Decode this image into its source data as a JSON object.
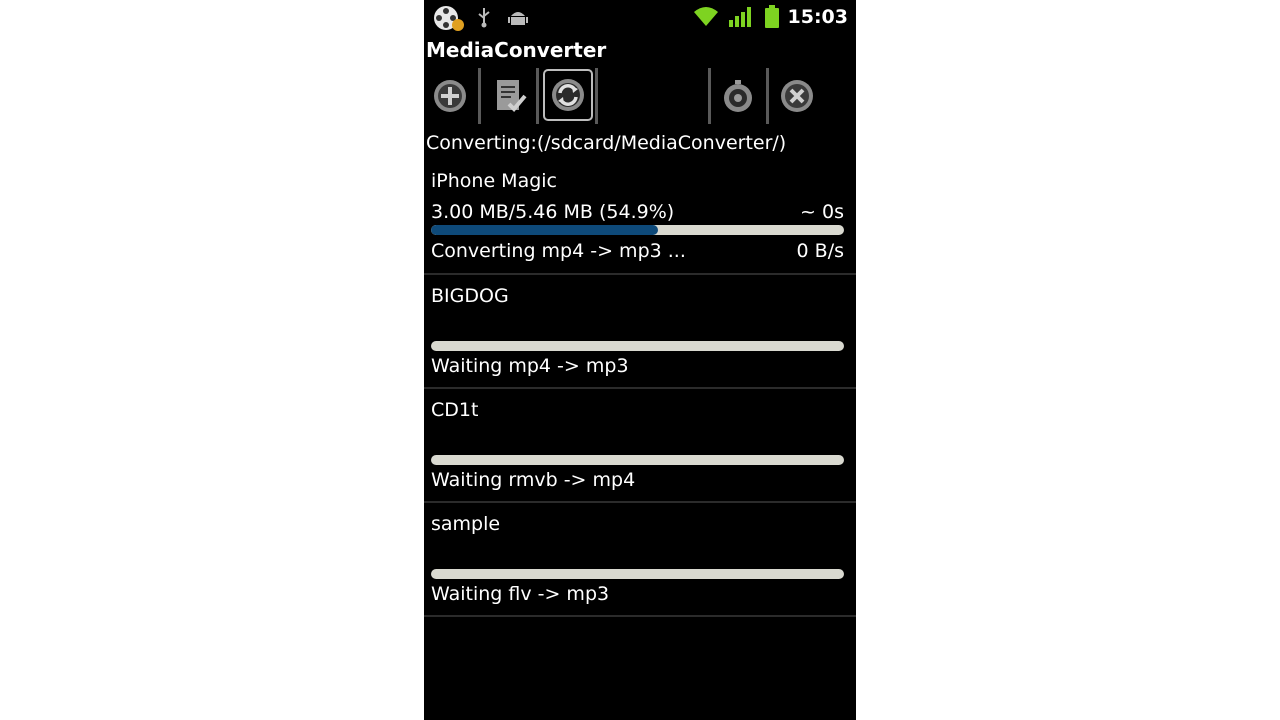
{
  "status_bar": {
    "time": "15:03",
    "icons": [
      "media-app-icon",
      "usb-icon",
      "android-debug-icon",
      "wifi-icon",
      "signal-icon",
      "battery-icon"
    ]
  },
  "app": {
    "title": "MediaConverter"
  },
  "toolbar": {
    "buttons": [
      {
        "name": "add",
        "icon": "plus-circle-icon"
      },
      {
        "name": "checklist",
        "icon": "checklist-icon"
      },
      {
        "name": "refresh",
        "icon": "refresh-icon",
        "active": true
      },
      {
        "name": "timer",
        "icon": "timer-icon"
      },
      {
        "name": "cancel",
        "icon": "x-circle-icon"
      }
    ]
  },
  "converting_path": "Converting:(/sdcard/MediaConverter/)",
  "colors": {
    "background": "#000000",
    "progress_fill": "#0e4a7a",
    "progress_track": "#d9d9d0",
    "accent_green": "#7ed321"
  },
  "queue": [
    {
      "name": "iPhone Magic",
      "size": "3.00 MB/5.46 MB (54.9%)",
      "eta": "~ 0s",
      "progress": 0.549,
      "status": "Converting mp4 -> mp3 ...",
      "speed": "0 B/s"
    },
    {
      "name": "BIGDOG",
      "size": "",
      "eta": "",
      "progress": 0,
      "status": "Waiting mp4 -> mp3",
      "speed": ""
    },
    {
      "name": "CD1t",
      "size": "",
      "eta": "",
      "progress": 0,
      "status": "Waiting rmvb -> mp4",
      "speed": ""
    },
    {
      "name": "sample",
      "size": "",
      "eta": "",
      "progress": 0,
      "status": "Waiting flv -> mp3",
      "speed": ""
    }
  ]
}
